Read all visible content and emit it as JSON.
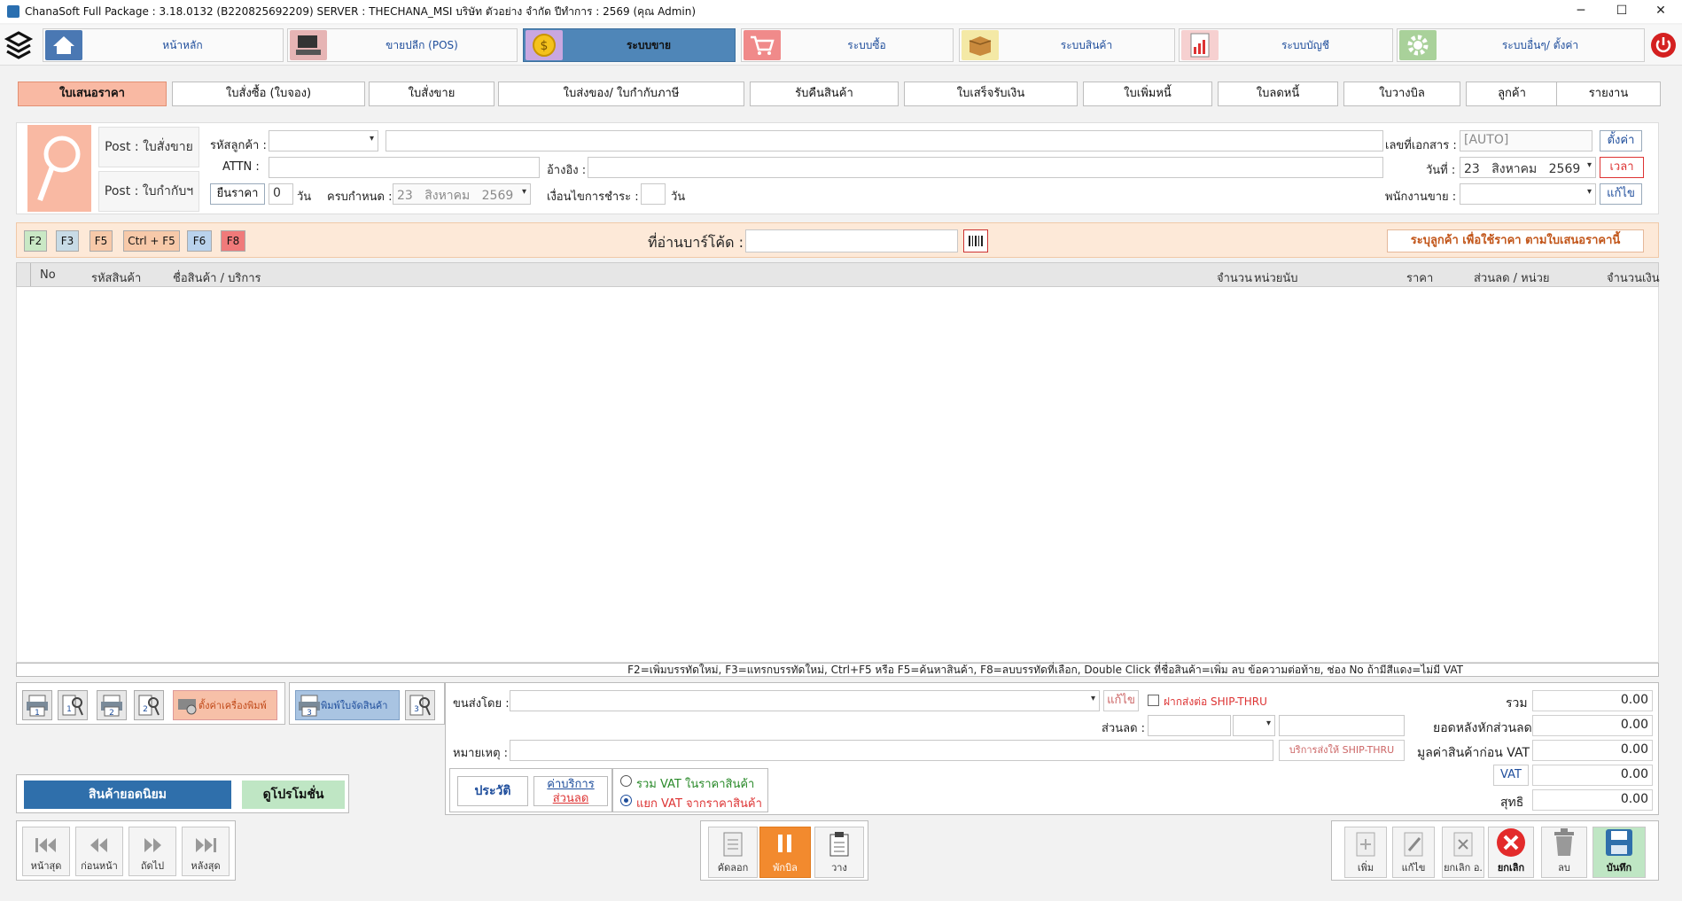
{
  "window": {
    "title": "ChanaSoft Full Package : 3.18.0132 (B220825692209) SERVER : THECHANA_MSI บริษัท ตัวอย่าง จำกัด ปีทำการ : 2569 (คุณ Admin)",
    "minimize": "─",
    "maximize": "☐",
    "close": "✕"
  },
  "topnav": {
    "items": [
      {
        "label": "หน้าหลัก",
        "icon": "home-icon"
      },
      {
        "label": "ขายปลีก (POS)",
        "icon": "pos-terminal-icon"
      },
      {
        "label": "ระบบขาย",
        "icon": "coin-icon"
      },
      {
        "label": "ระบบซื้อ",
        "icon": "cart-icon"
      },
      {
        "label": "ระบบสินค้า",
        "icon": "box-icon"
      },
      {
        "label": "ระบบบัญชี",
        "icon": "report-icon"
      },
      {
        "label": "ระบบอื่นๆ/ ตั้งค่า",
        "icon": "gear-icon"
      }
    ],
    "active": "ระบบขาย"
  },
  "tabs": [
    "ใบเสนอราคา",
    "ใบสั่งซื้อ (ใบจอง)",
    "ใบสั่งขาย",
    "ใบส่งของ/ ใบกำกับภาษี",
    "รับคืนสินค้า",
    "ใบเสร็จรับเงิน",
    "ใบเพิ่มหนี้",
    "ใบลดหนี้",
    "ใบวางบิล",
    "ลูกค้า",
    "รายงาน"
  ],
  "form": {
    "post_order": "Post : ใบสั่งขาย",
    "post_invoice": "Post : ใบกำกับฯ",
    "customer_code_label": "รหัสลูกค้า :",
    "customer_code_value": "",
    "customer_name_value": "",
    "attn_label": "ATTN :",
    "attn_value": "",
    "ref_label": "อ้างอิง :",
    "ref_value": "",
    "price_valid_button": "ยืนราคา",
    "price_valid_days": "0",
    "days_unit": "วัน",
    "due_label": "ครบกำหนด :",
    "due_day": "23",
    "due_month": "สิงหาคม",
    "due_year": "2569",
    "payment_terms_label": "เงื่อนไขการชำระ :",
    "payment_terms_value": "",
    "payment_days_unit": "วัน",
    "doc_no_label": "เลขที่เอกสาร :",
    "doc_no_value": "[AUTO]",
    "settings_button": "ตั้งค่า",
    "date_label": "วันที่ :",
    "date_day": "23",
    "date_month": "สิงหาคม",
    "date_year": "2569",
    "time_button": "เวลา",
    "salesperson_label": "พนักงานขาย :",
    "salesperson_value": "",
    "edit_button": "แก้ไข"
  },
  "barstrip": {
    "keys": [
      "F2",
      "F3",
      "F5",
      "Ctrl + F5",
      "F6",
      "F8"
    ],
    "barcode_label": "ที่อ่านบาร์โค้ด :",
    "barcode_value": "",
    "hint": "ระบุลูกค้า เพื่อใช้ราคา ตามใบเสนอราคานี้"
  },
  "grid": {
    "columns": [
      "No",
      "รหัสสินค้า",
      "ชื่อสินค้า / บริการ",
      "จำนวน",
      "หน่วยนับ",
      "ราคา",
      "ส่วนลด / หน่วย",
      "จำนวนเงิน"
    ],
    "rows": []
  },
  "help_text": "F2=เพิ่มบรรทัดใหม่,  F3=แทรกบรรทัดใหม่,  Ctrl+F5 หรือ F5=ค้นหาสินค้า,  F8=ลบบรรทัดที่เลือก,  Double Click ที่ชื่อสินค้า=เพิ่ม ลบ ข้อความต่อท้าย,  ช่อง No ถ้ามีสีแดง=ไม่มี VAT",
  "print": {
    "buttons": [
      "1",
      "1",
      "2",
      "2"
    ],
    "printer_setup": "ตั้งค่าเครื่องพิมพ์",
    "delivery_print": "พิมพ์ใบจัดสินค้า",
    "delivery_nums": [
      "3",
      "3"
    ]
  },
  "left_bottom": {
    "popular": "สินค้ายอดนิยม",
    "promo": "ดูโปรโมชั่น",
    "nav": [
      "หน้าสุด",
      "ก่อนหน้า",
      "ถัดไป",
      "หลังสุด"
    ]
  },
  "shipping": {
    "ship_by_label": "ขนส่งโดย :",
    "ship_by_value": "",
    "edit": "แก้ไข",
    "ship_thru": "ฝากส่งต่อ SHIP-THRU",
    "discount_label": "ส่วนลด :",
    "note_label": "หมายเหตุ :",
    "note_value": "",
    "ship_thru_service": "บริการส่งให้ SHIP-THRU",
    "history": "ประวัติ",
    "service_fee": "ค่าบริการ",
    "discount": "ส่วนลด",
    "vat_incl": "รวม VAT ในราคาสินค้า",
    "vat_excl": "แยก VAT จากราคาสินค้า",
    "vat_mode": "excl"
  },
  "totals": {
    "total_label": "รวม",
    "total": "0.00",
    "after_discount_label": "ยอดหลังหักส่วนลด",
    "after_discount": "0.00",
    "before_vat_label": "มูลค่าสินค้าก่อน VAT",
    "before_vat": "0.00",
    "vat_button": "VAT",
    "vat": "0.00",
    "net_label": "สุทธิ",
    "net": "0.00"
  },
  "center_actions": {
    "copy": "คัดลอก",
    "hold": "พักบิล",
    "paste": "วาง"
  },
  "right_actions": {
    "add": "เพิ่ม",
    "edit": "แก้ไข",
    "cancel_doc": "ยกเลิก อ.",
    "cancel": "ยกเลิก",
    "delete": "ลบ",
    "save": "บันทึก"
  },
  "colors": {
    "active_tab": "#f9b9a3",
    "active_nav": "#4f86b8",
    "hold_button": "#f28a2e",
    "cancel_red": "#e32b2b",
    "popular_blue": "#2f6fab",
    "promo_green": "#bfe6c4"
  }
}
